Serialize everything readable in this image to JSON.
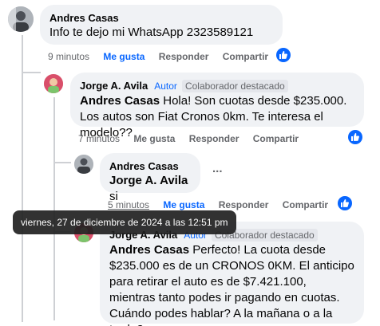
{
  "comments": [
    {
      "author": "Andres Casas",
      "text": "Info te dejo mi WhatsApp 2323589121",
      "time": "9 minutos",
      "like_label": "Me gusta",
      "reply_label": "Responder",
      "share_label": "Compartir"
    },
    {
      "author": "Jorge A. Avila",
      "author_badge": "Autor",
      "top_badge": "Colaborador destacado",
      "mention": "Andres Casas",
      "text": " Hola! Son cuotas desde $235.000. Los autos son Fiat Cronos 0km. Te interesa el modelo??",
      "time": "7 minutos",
      "like_label": "Me gusta",
      "reply_label": "Responder",
      "share_label": "Compartir"
    },
    {
      "author": "Andres Casas",
      "mention": "Jorge A. Avila",
      "text": " si",
      "time": "5 minutos",
      "like_label": "Me gusta",
      "reply_label": "Responder",
      "share_label": "Compartir",
      "more_label": "..."
    },
    {
      "author": "Jorge A. Avila",
      "author_badge": "Autor",
      "top_badge": "Colaborador destacado",
      "mention": "Andres Casas",
      "text": " Perfecto! La cuota desde $235.000 es de un CRONOS 0KM. El anticipo para retirar el auto es de $7.421.100, mientras tanto podes ir pagando en cuotas. Cuándo podes hablar? A la mañana o a la tarde?"
    }
  ],
  "tooltip": "viernes, 27 de diciembre de 2024 a las 12:51 pm",
  "colors": {
    "accent": "#0866ff",
    "bubble": "#f0f2f5",
    "muted": "#65676b"
  }
}
